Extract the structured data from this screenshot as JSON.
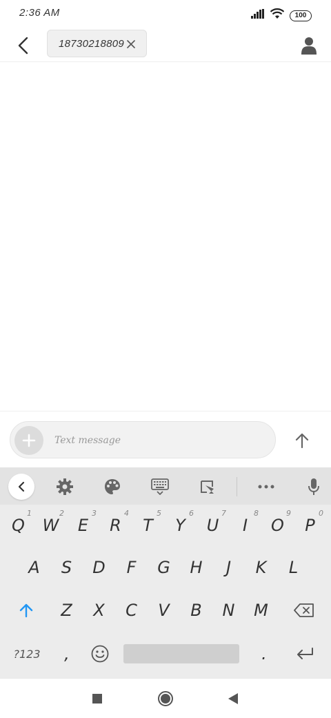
{
  "status_bar": {
    "time": "2:36 AM",
    "battery": "100"
  },
  "header": {
    "recipient_chip": "18730218809"
  },
  "compose": {
    "placeholder": "Text message"
  },
  "keyboard": {
    "row1": [
      {
        "key": "Q",
        "hint": "1"
      },
      {
        "key": "W",
        "hint": "2"
      },
      {
        "key": "E",
        "hint": "3"
      },
      {
        "key": "R",
        "hint": "4"
      },
      {
        "key": "T",
        "hint": "5"
      },
      {
        "key": "Y",
        "hint": "6"
      },
      {
        "key": "U",
        "hint": "7"
      },
      {
        "key": "I",
        "hint": "8"
      },
      {
        "key": "O",
        "hint": "9"
      },
      {
        "key": "P",
        "hint": "0"
      }
    ],
    "row2": [
      "A",
      "S",
      "D",
      "F",
      "G",
      "H",
      "J",
      "K",
      "L"
    ],
    "row3": [
      "Z",
      "X",
      "C",
      "V",
      "B",
      "N",
      "M"
    ],
    "symbols_label": "?123",
    "comma": ",",
    "period": "."
  },
  "colors": {
    "accent": "#2196F3",
    "keyboard_bg": "#ececec",
    "toolbar_bg": "#e3e3e3"
  }
}
